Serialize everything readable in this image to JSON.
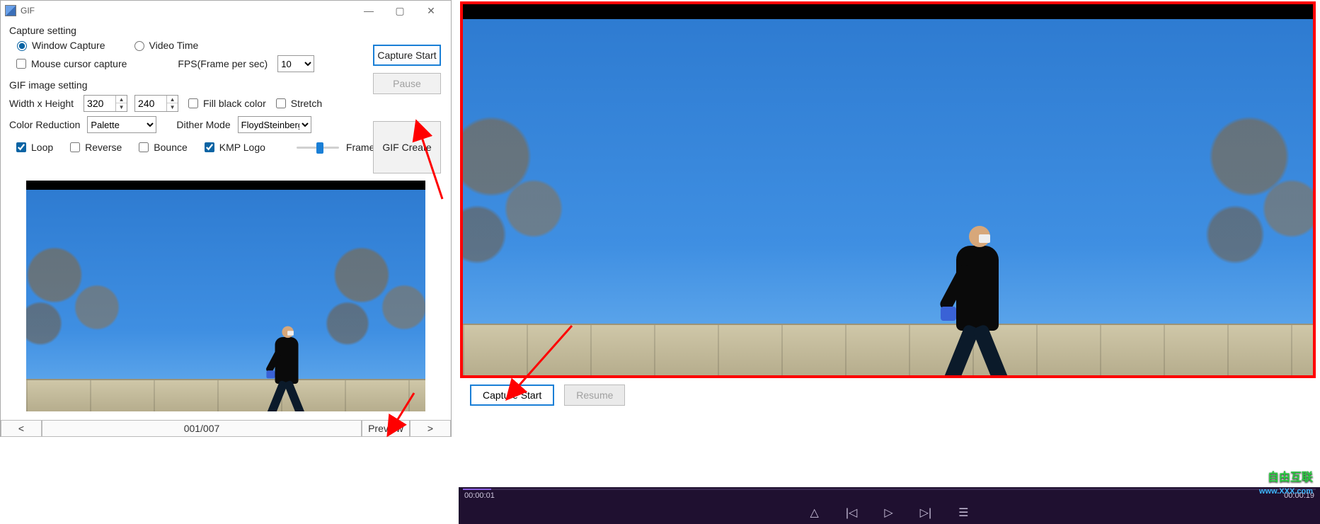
{
  "dialog": {
    "title": "GIF",
    "capture_setting_label": "Capture setting",
    "radio_window_capture": "Window Capture",
    "radio_video_time": "Video Time",
    "chk_mouse_cursor": "Mouse cursor capture",
    "fps_label": "FPS(Frame per sec)",
    "fps_value": "10",
    "gif_image_setting_label": "GIF image setting",
    "width_height_label": "Width x Height",
    "width_value": "320",
    "height_value": "240",
    "chk_fill_black": "Fill black color",
    "chk_stretch": "Stretch",
    "color_reduction_label": "Color Reduction",
    "color_reduction_value": "Palette",
    "dither_mode_label": "Dither Mode",
    "dither_mode_value": "FloydSteinberg",
    "chk_loop": "Loop",
    "chk_reverse": "Reverse",
    "chk_bounce": "Bounce",
    "chk_kmp_logo": "KMP Logo",
    "frame_speed_label": "Frame Speed",
    "btn_capture_start": "Capture Start",
    "btn_pause": "Pause",
    "btn_gif_create": "GIF Create"
  },
  "bottom": {
    "prev": "<",
    "page": "001/007",
    "preview": "Preview",
    "next": ">"
  },
  "video": {
    "btn_capture_start": "Capture Start",
    "btn_resume": "Resume",
    "time_current": "00:00:01",
    "time_total": "00:00:19"
  },
  "watermark": {
    "line1": "自由互联",
    "line2": "www.XXX.com"
  }
}
